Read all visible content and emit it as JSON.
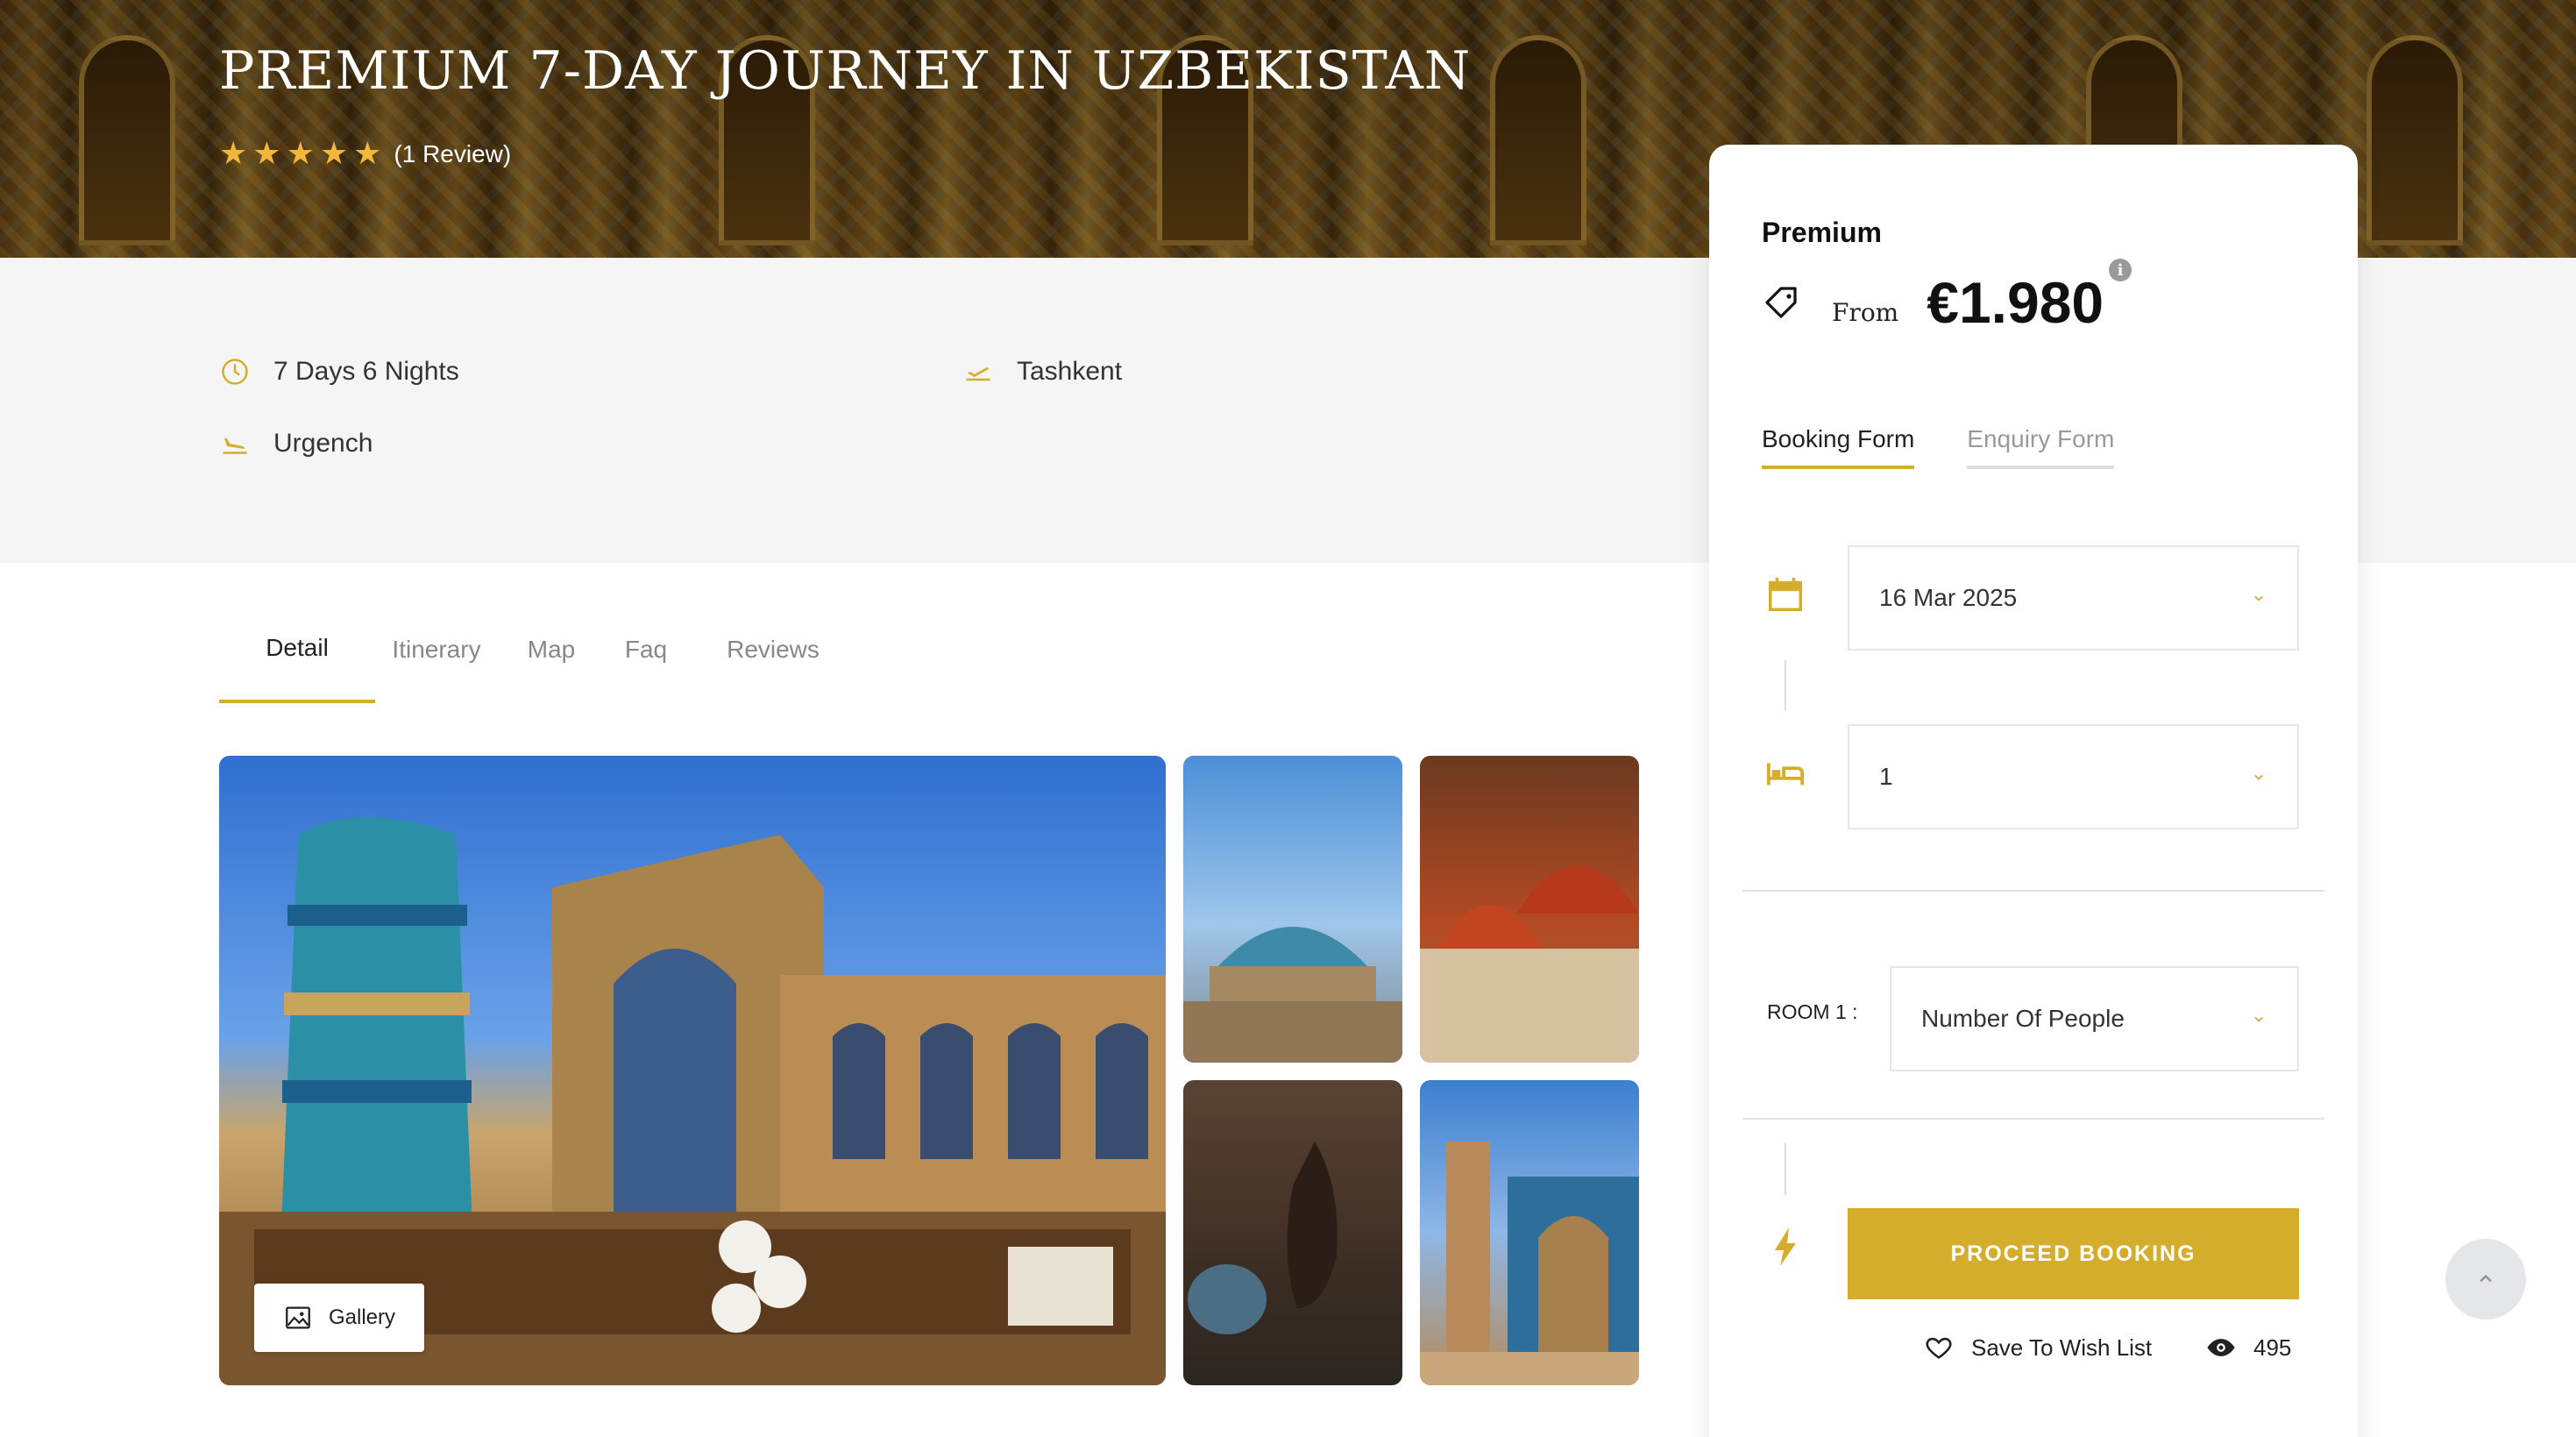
{
  "hero": {
    "title": "PREMIUM 7-DAY JOURNEY IN UZBEKISTAN",
    "rating_stars": 5,
    "review_count": "(1 Review)"
  },
  "info": {
    "duration": "7 Days 6 Nights",
    "departure": "Tashkent",
    "arrival": "Urgench"
  },
  "tabs": [
    {
      "label": "Detail",
      "active": true
    },
    {
      "label": "Itinerary",
      "active": false
    },
    {
      "label": "Map",
      "active": false
    },
    {
      "label": "Faq",
      "active": false
    },
    {
      "label": "Reviews",
      "active": false
    }
  ],
  "gallery": {
    "button_label": "Gallery"
  },
  "booking": {
    "plan_name": "Premium",
    "from_label": "From",
    "price": "€1.980",
    "form_tabs": [
      {
        "label": "Booking Form",
        "active": true
      },
      {
        "label": "Enquiry Form",
        "active": false
      }
    ],
    "date_value": "16 Mar 2025",
    "rooms_value": "1",
    "room_label": "ROOM 1 :",
    "people_placeholder": "Number Of People",
    "proceed_label": "PROCEED BOOKING",
    "wish_label": "Save To Wish List",
    "view_count": "495"
  },
  "colors": {
    "accent": "#d4ad2c",
    "star": "#f2b63a",
    "band_bg": "#f5f5f5"
  }
}
